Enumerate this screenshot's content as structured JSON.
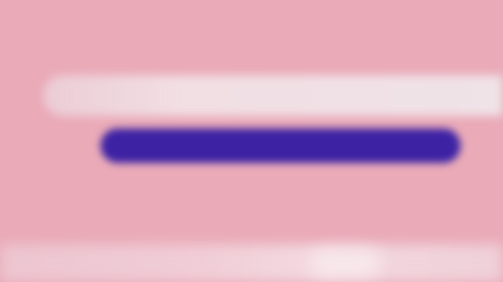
{
  "colors": {
    "background": "#eaaab8",
    "banner": "#efe3e8",
    "bar": "#4a2f9e",
    "bar_fill": "#3d22a4",
    "footer": "#f0cdd6"
  },
  "progress": {
    "fraction": 1.0
  }
}
